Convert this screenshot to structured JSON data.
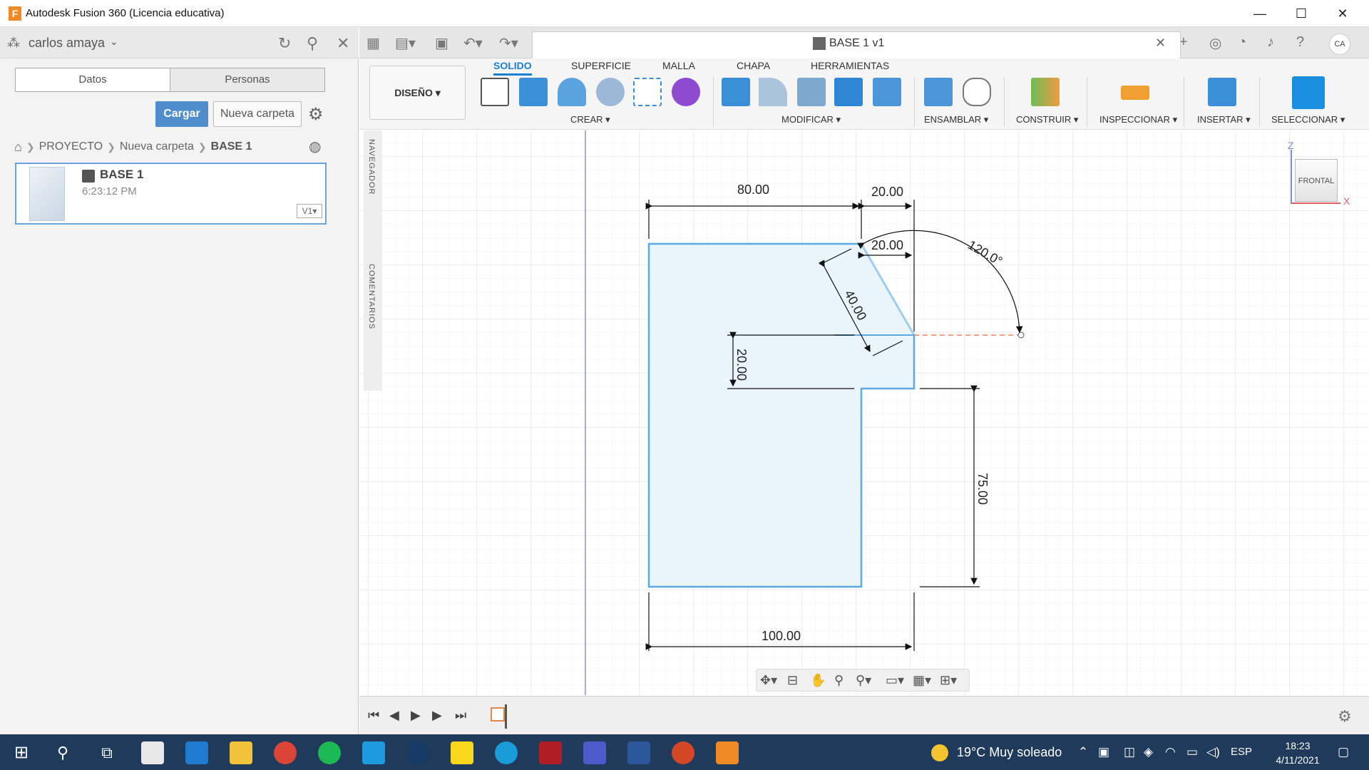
{
  "window": {
    "title": "Autodesk Fusion 360 (Licencia educativa)",
    "app_icon": "F",
    "minimize": "—",
    "maximize": "☐",
    "close": "✕"
  },
  "left_panel": {
    "user": "carlos amaya",
    "tabs": [
      "Datos",
      "Personas"
    ],
    "buttons": {
      "upload": "Cargar",
      "new_folder": "Nueva carpeta"
    },
    "breadcrumb": [
      "PROYECTO",
      "Nueva carpeta",
      "BASE 1"
    ],
    "file": {
      "name": "BASE 1",
      "time": "6:23:12 PM",
      "version": "V1▾"
    }
  },
  "document_tab": {
    "title": "BASE 1 v1",
    "avatar": "CA"
  },
  "ribbon": {
    "design_button": "DISEÑO ▾",
    "tabs": [
      "SOLIDO",
      "SUPERFICIE",
      "MALLA",
      "CHAPA",
      "HERRAMIENTAS"
    ],
    "groups": [
      "CREAR ▾",
      "MODIFICAR ▾",
      "ENSAMBLAR ▾",
      "CONSTRUIR ▾",
      "INSPECCIONAR ▾",
      "INSERTAR ▾",
      "SELECCIONAR ▾"
    ]
  },
  "side_labels": {
    "navigator": "NAVEGADOR",
    "comments": "COMENTARIOS"
  },
  "viewcube": {
    "face": "FRONTAL",
    "z": "Z",
    "x": "X"
  },
  "sketch": {
    "dim_top_left": "80.00",
    "dim_top_right": "20.00",
    "dim_inner_top": "20.00",
    "dim_angle": "120.0°",
    "dim_slant": "40.00",
    "dim_notch": "20.00",
    "dim_right_height": "75.00",
    "dim_bottom": "100.00"
  },
  "taskbar": {
    "weather": "19°C  Muy soleado",
    "language": "ESP",
    "time": "18:23",
    "date": "4/11/2021"
  },
  "colors": {
    "accent": "#1a7fd6",
    "sketch_line": "#5aa9e6",
    "sketch_fill": "#eaf4fb",
    "taskbar": "#1f3a5a"
  }
}
